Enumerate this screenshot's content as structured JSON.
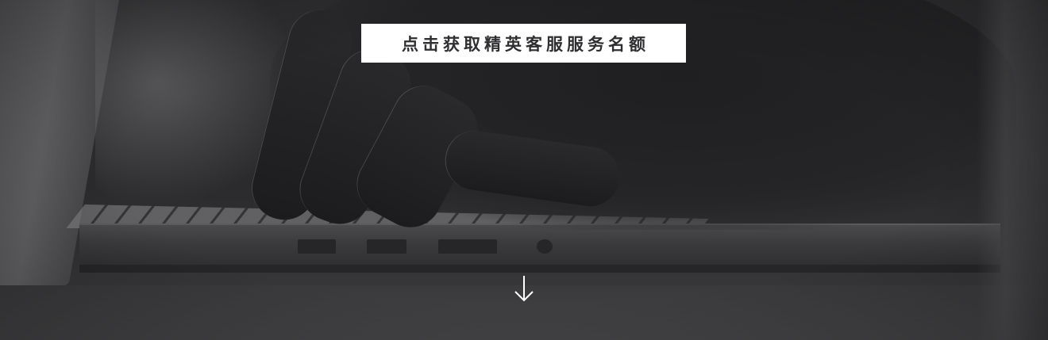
{
  "hero": {
    "background_image": "hand-typing-on-laptop-photo",
    "overlay_color": "#2f2f31"
  },
  "cta": {
    "label": "点击获取精英客服服务名额",
    "background_color": "#ffffff",
    "text_color": "#2f2f31"
  },
  "scroll_indicator": {
    "icon": "arrow-down-icon",
    "color": "#ffffff"
  }
}
